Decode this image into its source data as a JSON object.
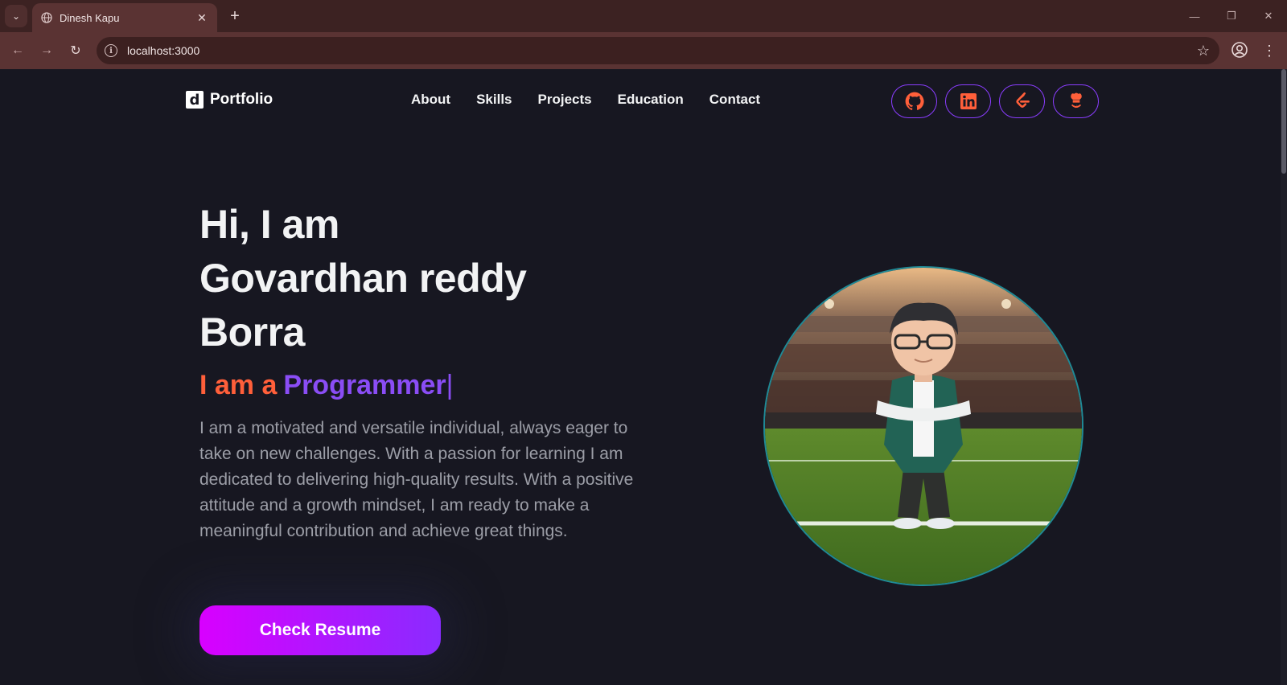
{
  "browser": {
    "tab_title": "Dinesh Kapu",
    "url": "localhost:3000",
    "icons": {
      "tab_list": "chevron-down-icon",
      "globe": "globe-icon",
      "close": "close-icon",
      "new_tab": "plus-icon",
      "back": "back-arrow-icon",
      "forward": "forward-arrow-icon",
      "reload": "reload-icon",
      "site_info": "info-icon",
      "bookmark": "star-icon",
      "profile": "profile-icon",
      "menu": "kebab-menu-icon"
    }
  },
  "navbar": {
    "logo_text": "Portfolio",
    "logo_mark": "d",
    "links": [
      "About",
      "Skills",
      "Projects",
      "Education",
      "Contact"
    ],
    "socials": [
      "github-icon",
      "linkedin-icon",
      "leetcode-icon",
      "codechef-icon"
    ]
  },
  "hero": {
    "title_line1": "Hi, I am",
    "title_line2": "Govardhan reddy",
    "title_line3": "Borra",
    "subtitle_lead": "I am a",
    "subtitle_role": "Programmer",
    "subtitle_caret": "|",
    "description": "I am a motivated and versatile individual, always eager to take on new challenges. With a passion for learning I am dedicated to delivering high-quality results. With a positive attitude and a growth mindset, I am ready to make a meaningful contribution and achieve great things.",
    "resume_button": "Check Resume"
  },
  "colors": {
    "background": "#171721",
    "accent_orange": "#ff5f3a",
    "accent_purple": "#8a4df5",
    "button_gradient_start": "#d800ff",
    "button_gradient_end": "#8a2bff",
    "avatar_border": "#1f8a96"
  }
}
